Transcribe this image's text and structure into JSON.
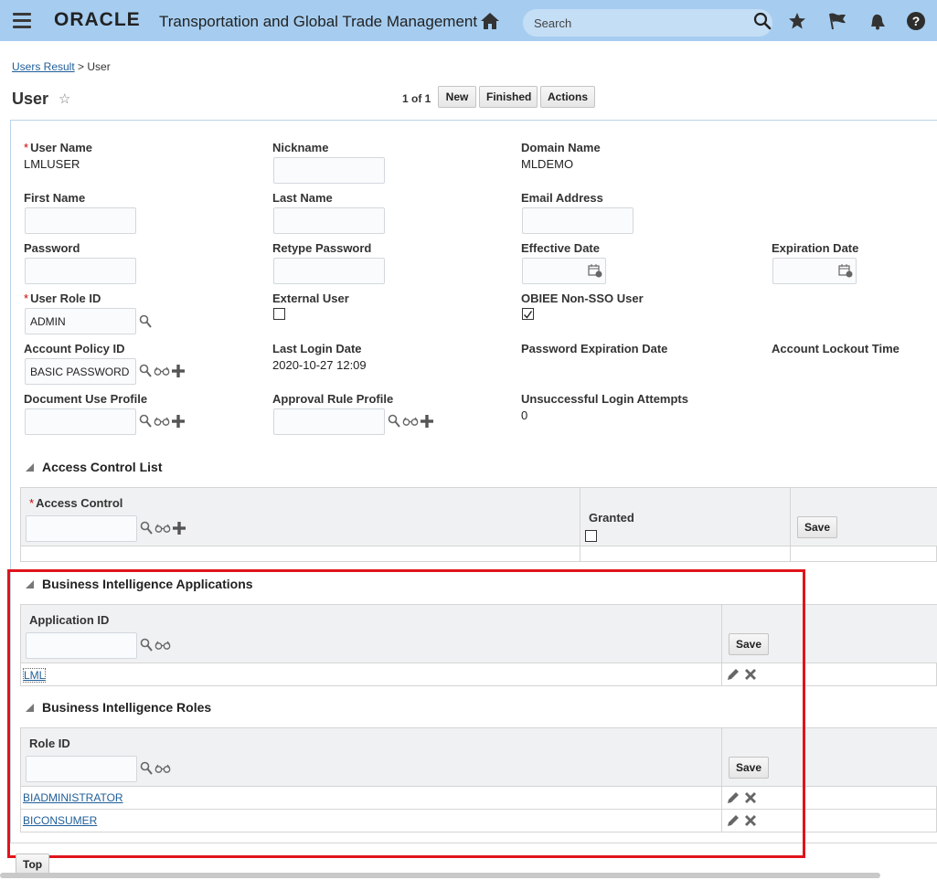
{
  "header": {
    "brand": "ORACLE",
    "app_title": "Transportation and Global Trade Management",
    "search_placeholder": "Search"
  },
  "breadcrumb": {
    "parent": "Users Result",
    "separator": ">",
    "current": "User"
  },
  "page": {
    "title": "User",
    "pager": "1 of 1"
  },
  "toolbar": {
    "new": "New",
    "finished": "Finished",
    "actions": "Actions"
  },
  "form": {
    "user_name_label": "User Name",
    "user_name_value": "LMLUSER",
    "nickname_label": "Nickname",
    "domain_name_label": "Domain Name",
    "domain_name_value": "MLDEMO",
    "first_name_label": "First Name",
    "last_name_label": "Last Name",
    "email_label": "Email Address",
    "password_label": "Password",
    "retype_password_label": "Retype Password",
    "effective_date_label": "Effective Date",
    "expiration_date_label": "Expiration Date",
    "user_role_label": "User Role ID",
    "user_role_value": "ADMIN",
    "external_user_label": "External User",
    "external_user_checked": false,
    "obiee_label": "OBIEE Non-SSO User",
    "obiee_checked": true,
    "account_policy_label": "Account Policy ID",
    "account_policy_value": "BASIC PASSWORD",
    "last_login_label": "Last Login Date",
    "last_login_value": "2020-10-27 12:09",
    "password_expiration_label": "Password Expiration Date",
    "account_lockout_label": "Account Lockout Time",
    "doc_use_profile_label": "Document Use Profile",
    "approval_rule_label": "Approval Rule Profile",
    "unsuccessful_login_label": "Unsuccessful Login Attempts",
    "unsuccessful_login_value": "0",
    "required_mark": "*"
  },
  "access_control": {
    "title": "Access Control List",
    "col_access": "Access Control",
    "col_granted": "Granted",
    "granted_checked": false,
    "save": "Save"
  },
  "bi_apps": {
    "title": "Business Intelligence Applications",
    "col_app_id": "Application ID",
    "save": "Save",
    "rows": [
      "LML"
    ]
  },
  "bi_roles": {
    "title": "Business Intelligence Roles",
    "col_role_id": "Role ID",
    "save": "Save",
    "rows": [
      "BIADMINISTRATOR",
      "BICONSUMER"
    ]
  },
  "footer": {
    "top": "Top"
  },
  "colors": {
    "topbar": "#a6cdf0",
    "link": "#1f5e99",
    "highlight": "#e0141c"
  }
}
